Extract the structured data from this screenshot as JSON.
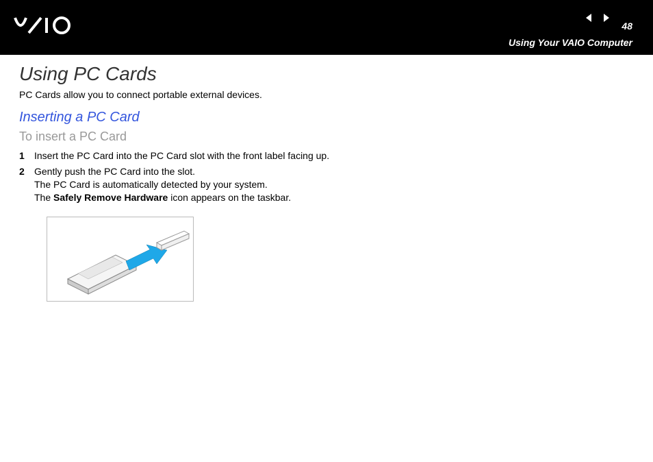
{
  "header": {
    "logo": "VAIO",
    "page_number": "48",
    "section": "Using Your VAIO Computer"
  },
  "content": {
    "h1": "Using PC Cards",
    "intro": "PC Cards allow you to connect portable external devices.",
    "h2": "Inserting a PC Card",
    "h3": "To insert a PC Card",
    "steps": [
      {
        "num": "1",
        "text": "Insert the PC Card into the PC Card slot with the front label facing up."
      },
      {
        "num": "2",
        "line1": "Gently push the PC Card into the slot.",
        "line2": "The PC Card is automatically detected by your system.",
        "line3a": "The ",
        "line3b": "Safely Remove Hardware",
        "line3c": " icon appears on the taskbar."
      }
    ]
  }
}
